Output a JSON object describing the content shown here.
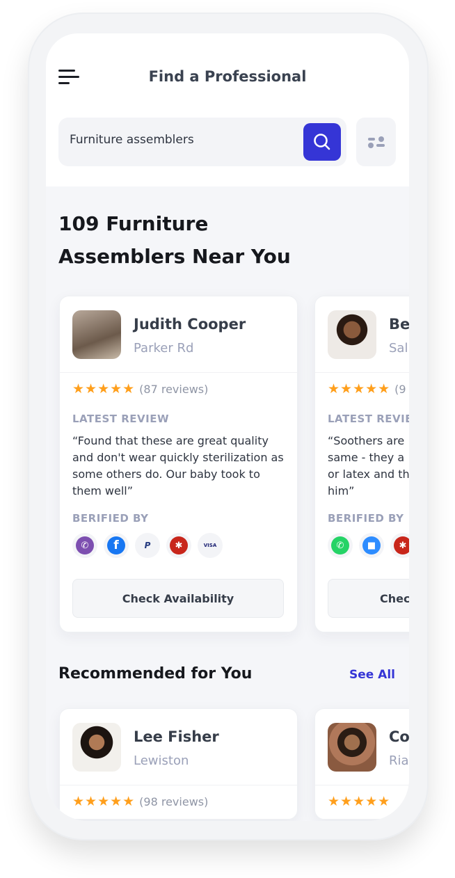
{
  "header": {
    "title": "Find a Professional",
    "search_value": "Furniture assemblers"
  },
  "results": {
    "heading": "109 Furniture Assemblers Near You",
    "cards": [
      {
        "name": "Judith Cooper",
        "location": "Parker Rd",
        "rating": 5,
        "reviews": "(87 reviews)",
        "review_label": "LATEST REVIEW",
        "review": "“Found that these are great quality and don't wear quickly sterilization as some others do. Our baby took to them well”",
        "verified_label": "BERIFIED BY",
        "verified": [
          "viber",
          "facebook",
          "paypal",
          "yelp",
          "visa"
        ],
        "button": "Check Availability"
      },
      {
        "name": "Bes",
        "location": "Sal",
        "rating": 5,
        "reviews": "(9",
        "review_label": "LATEST REVIEW",
        "review": "“Soothers are same - they a or latex and th him”",
        "verified_label": "BERIFIED BY",
        "verified": [
          "whatsapp",
          "zoom",
          "yelp"
        ],
        "button": "Chec"
      }
    ]
  },
  "recommended": {
    "heading": "Recommended for You",
    "see_all": "See All",
    "cards": [
      {
        "name": "Lee Fisher",
        "location": "Lewiston",
        "rating": 5,
        "reviews": "(98 reviews)"
      },
      {
        "name": "Co",
        "location": "Ria",
        "rating": 5,
        "reviews": ""
      }
    ]
  },
  "colors": {
    "accent": "#3535d6",
    "star": "#ff9f1c"
  }
}
